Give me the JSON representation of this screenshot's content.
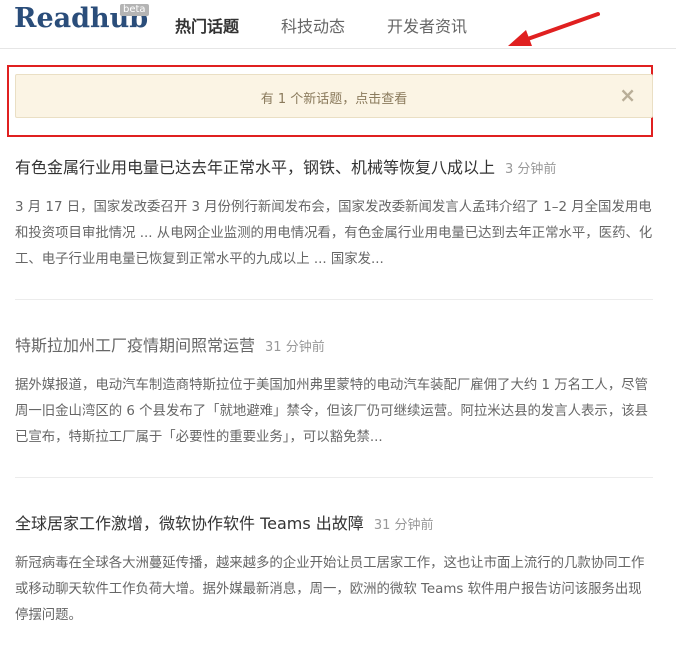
{
  "header": {
    "logo": "Readhub",
    "beta": "beta",
    "tabs": [
      {
        "label": "热门话题",
        "active": true
      },
      {
        "label": "科技动态",
        "active": false
      },
      {
        "label": "开发者资讯",
        "active": false
      }
    ]
  },
  "notice": {
    "text": "有 1 个新话题，点击查看",
    "close": "×"
  },
  "topics": [
    {
      "title": "有色金属行业用电量已达去年正常水平，钢铁、机械等恢复八成以上",
      "time": "3 分钟前",
      "summary": "3 月 17 日，国家发改委召开 3 月份例行新闻发布会，国家发改委新闻发言人孟玮介绍了 1–2 月全国发用电和投资项目审批情况 ... 从电网企业监测的用电情况看，有色金属行业用电量已达到去年正常水平，医药、化工、电子行业用电量已恢复到正常水平的九成以上 ... 国家发..."
    },
    {
      "title": "特斯拉加州工厂疫情期间照常运营",
      "time": "31 分钟前",
      "summary": "据外媒报道，电动汽车制造商特斯拉位于美国加州弗里蒙特的电动汽车装配厂雇佣了大约 1 万名工人，尽管周一旧金山湾区的 6 个县发布了「就地避难」禁令，但该厂仍可继续运营。阿拉米达县的发言人表示，该县已宣布，特斯拉工厂属于「必要性的重要业务」，可以豁免禁..."
    },
    {
      "title": "全球居家工作激增，微软协作软件 Teams 出故障",
      "time": "31 分钟前",
      "summary": "新冠病毒在全球各大洲蔓延传播，越来越多的企业开始让员工居家工作，这也让市面上流行的几款协同工作或移动聊天软件工作负荷大增。据外媒最新消息，周一，欧洲的微软 Teams 软件用户报告访问该服务出现停摆问题。"
    }
  ]
}
